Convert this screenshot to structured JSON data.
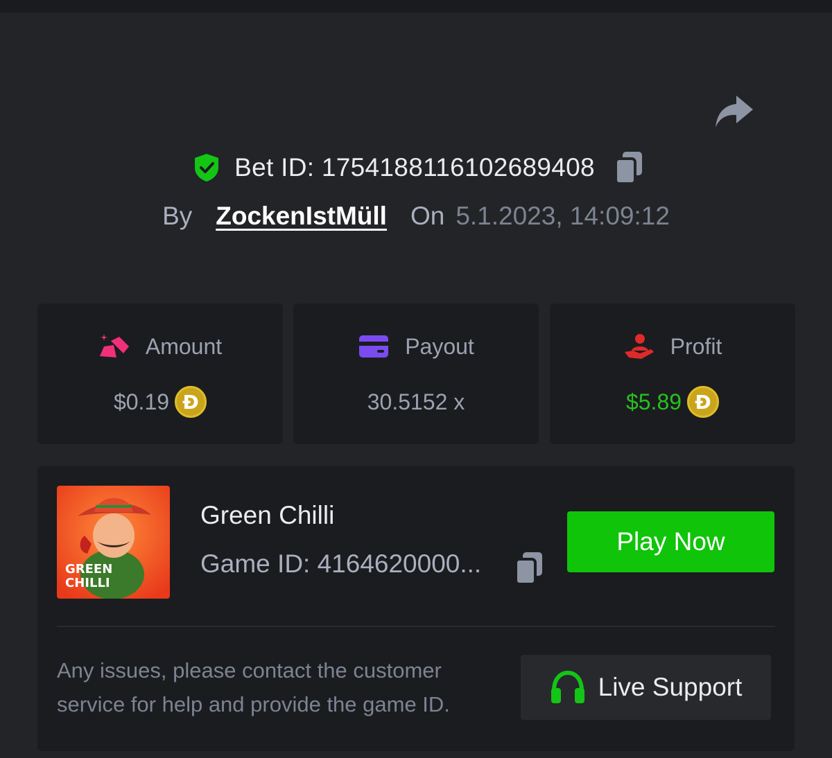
{
  "bet": {
    "label_prefix": "Bet ID: ",
    "id": "1754188116102689408",
    "by_label": "By",
    "username": "ZockenIstMüll",
    "on_label": "On",
    "date": "5.1.2023, 14:09:12"
  },
  "stats": {
    "amount": {
      "title": "Amount",
      "value": "$0.19",
      "currency_icon": "dogecoin-icon"
    },
    "payout": {
      "title": "Payout",
      "value": "30.5152 x"
    },
    "profit": {
      "title": "Profit",
      "value": "$5.89",
      "currency_icon": "dogecoin-icon"
    },
    "coin_symbol": "Ð"
  },
  "game": {
    "name": "Green Chilli",
    "id_label": "Game ID: 4164620000...",
    "thumb_text_line1": "GREEN",
    "thumb_text_line2": "CHILLI",
    "play_label": "Play Now"
  },
  "support": {
    "notice": "Any issues, please contact the customer service for help and provide the game ID.",
    "button_label": "Live Support"
  },
  "colors": {
    "background": "#232427",
    "card": "#1b1c1f",
    "accent_green": "#10c40a",
    "profit_green": "#25c21f",
    "amount_icon": "#f0307a",
    "payout_icon": "#7a4cf0",
    "profit_icon": "#e02a2a"
  }
}
